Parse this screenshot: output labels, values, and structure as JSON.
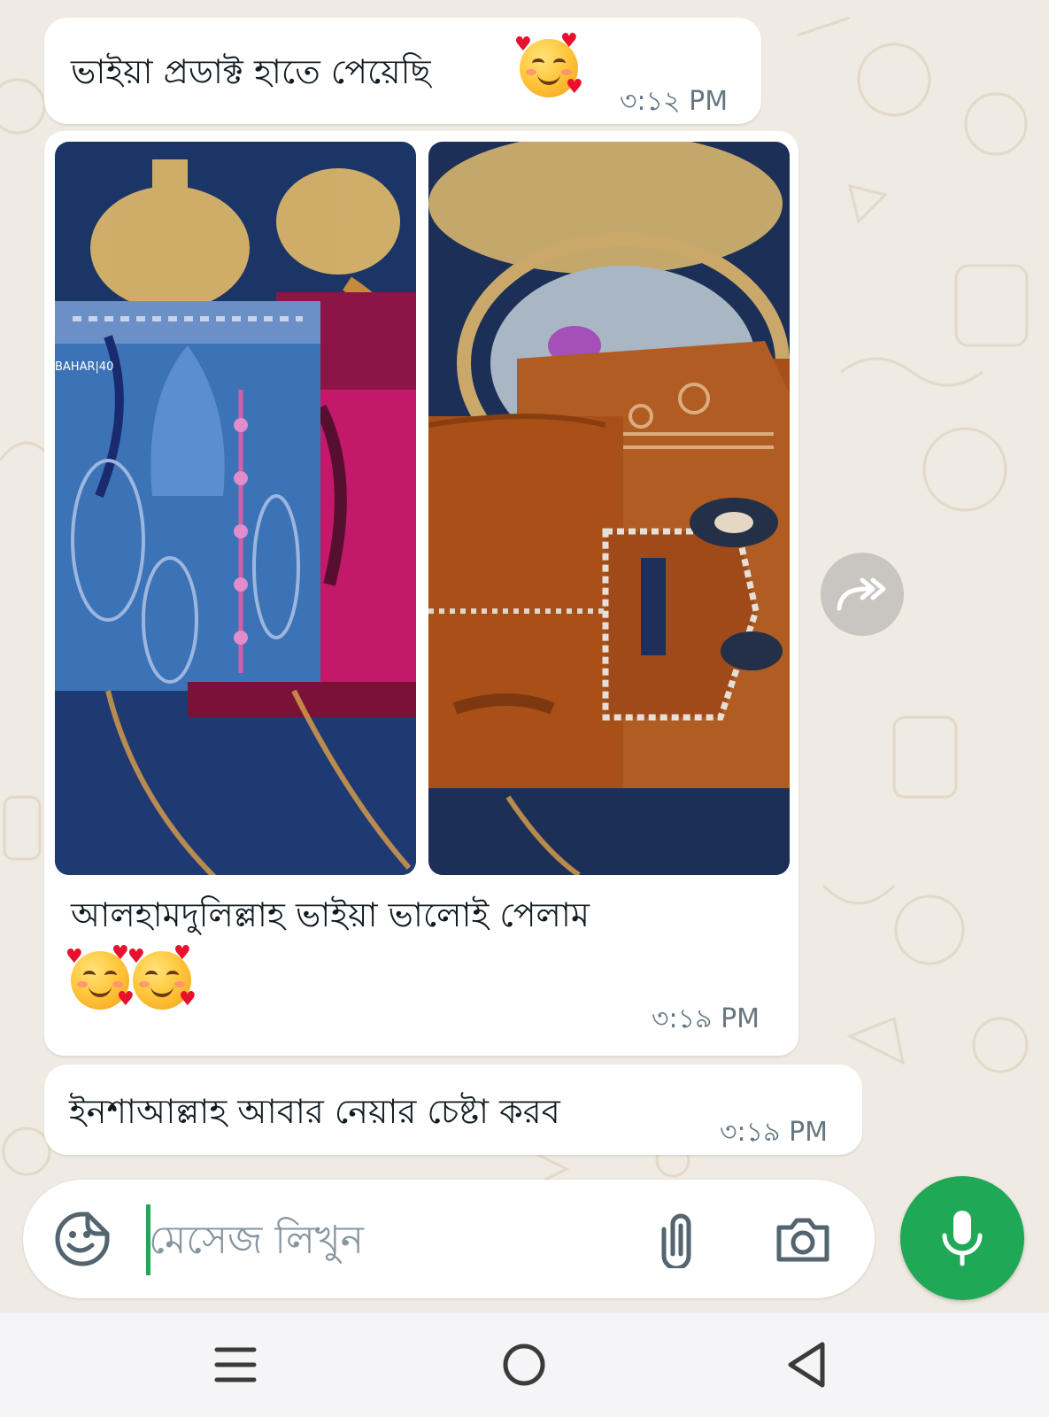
{
  "messages": [
    {
      "text": "ভাইয়া প্রডাক্ট হাতে পেয়েছি",
      "emoji": [
        "smiling-face-with-hearts"
      ],
      "time": "৩:১২ PM"
    },
    {
      "photos": [
        {
          "label": "blue-and-magenta-printed-dress-sets-photo"
        },
        {
          "label": "rust-orange-printed-dress-set-photo"
        }
      ],
      "caption": "আলহামদুলিল্লাহ ভাইয়া ভালোই পেলাম",
      "emoji": [
        "smiling-face-with-hearts",
        "smiling-face-with-hearts"
      ],
      "time": "৩:১৯ PM"
    },
    {
      "text": "ইনশাআল্লাহ আবার নেয়ার চেষ্টা করব",
      "time": "৩:১৯ PM"
    }
  ],
  "composer": {
    "placeholder": "মেসেজ লিখুন",
    "value": ""
  },
  "icons": {
    "sticker": "sticker-icon",
    "attach": "paperclip-icon",
    "camera": "camera-icon",
    "mic": "microphone-icon",
    "forward": "forward-icon"
  },
  "nav": [
    "menu-icon",
    "home-icon",
    "back-icon"
  ],
  "colors": {
    "wallpaper": "#efeae2",
    "bubble": "#ffffff",
    "accent_green": "#1fa855",
    "timestamp": "#667781"
  }
}
